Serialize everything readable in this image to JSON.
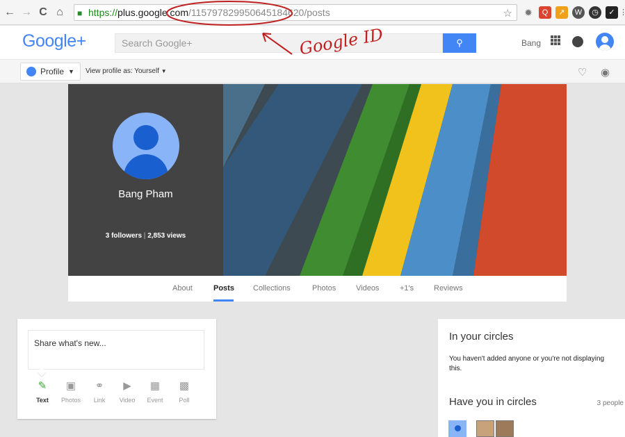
{
  "browser": {
    "url_scheme": "https://",
    "url_host": "plus.google.com",
    "url_path": "/115797829950645184620/posts",
    "nav": [
      "back-icon",
      "forward-icon",
      "reload-icon",
      "home-icon"
    ],
    "extensions": [
      "puzzle-icon",
      "extension-red-icon",
      "extension-orange-icon",
      "extension-w-icon",
      "clock-icon",
      "extension-check-icon"
    ]
  },
  "annotation": {
    "text": "Google ID",
    "color": "#c02020"
  },
  "header": {
    "logo": "Google+",
    "search_placeholder": "Search Google+",
    "user_name": "Bang"
  },
  "subbar": {
    "profile_label": "Profile",
    "view_as": "View profile as: Yourself"
  },
  "profile": {
    "name": "Bang Pham",
    "followers": "3 followers",
    "views": "2,853 views",
    "cover_colors": [
      "#2d3a44",
      "#3b8a2e",
      "#f3c11b",
      "#4a8fc9",
      "#d0432b"
    ]
  },
  "tabs": [
    {
      "label": "About"
    },
    {
      "label": "Posts",
      "active": true
    },
    {
      "label": "Collections"
    },
    {
      "label": "Photos"
    },
    {
      "label": "Videos"
    },
    {
      "label": "+1's"
    },
    {
      "label": "Reviews"
    }
  ],
  "share": {
    "placeholder": "Share what's new...",
    "options": [
      {
        "label": "Text",
        "icon": "pencil-icon",
        "active": true
      },
      {
        "label": "Photos",
        "icon": "camera-icon"
      },
      {
        "label": "Link",
        "icon": "link-icon"
      },
      {
        "label": "Video",
        "icon": "video-icon"
      },
      {
        "label": "Event",
        "icon": "event-icon"
      },
      {
        "label": "Poll",
        "icon": "poll-icon"
      }
    ]
  },
  "circles": {
    "title": "In your circles",
    "text": "You haven't added anyone or you're not displaying this.",
    "have_title": "Have you in circles",
    "have_count": "3 people"
  },
  "colors": {
    "accent": "#4285f4",
    "cover_dark": "#434343"
  }
}
